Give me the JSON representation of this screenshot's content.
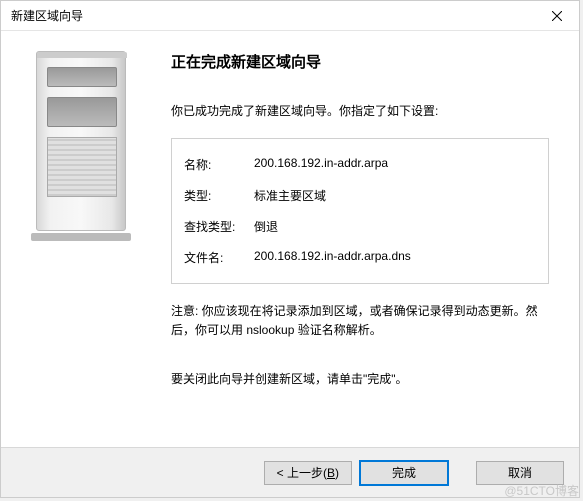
{
  "titlebar": {
    "title": "新建区域向导"
  },
  "main": {
    "heading": "正在完成新建区域向导",
    "subtext": "你已成功完成了新建区域向导。你指定了如下设置:",
    "rows": {
      "name_label": "名称:",
      "name_value": "200.168.192.in-addr.arpa",
      "type_label": "类型:",
      "type_value": "标准主要区域",
      "lookup_label": "查找类型:",
      "lookup_value": "倒退",
      "file_label": "文件名:",
      "file_value": "200.168.192.in-addr.arpa.dns"
    },
    "note": "注意: 你应该现在将记录添加到区域，或者确保记录得到动态更新。然后，你可以用 nslookup 验证名称解析。",
    "closing": "要关闭此向导并创建新区域，请单击\"完成\"。"
  },
  "buttons": {
    "back_prefix": "< 上一步(",
    "back_key": "B",
    "back_suffix": ")",
    "finish": "完成",
    "cancel": "取消"
  },
  "watermark": "@51CTO博客"
}
